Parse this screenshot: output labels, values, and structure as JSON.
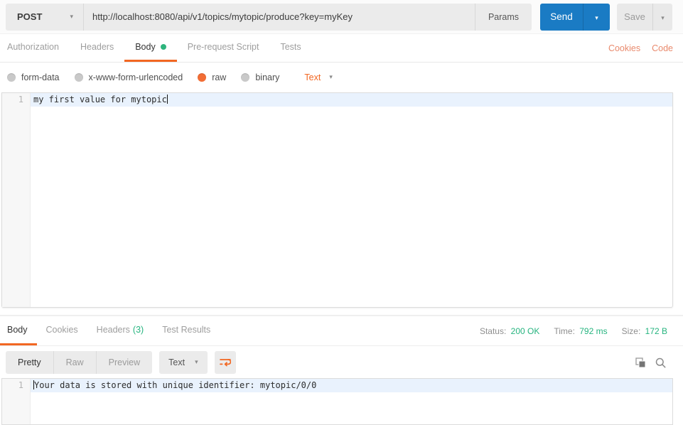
{
  "request": {
    "method": "POST",
    "url": "http://localhost:8080/api/v1/topics/mytopic/produce?key=myKey",
    "params_label": "Params",
    "send_label": "Send",
    "save_label": "Save"
  },
  "request_tabs": {
    "items": [
      "Authorization",
      "Headers",
      "Body",
      "Pre-request Script",
      "Tests"
    ],
    "active": "Body",
    "cookies_link": "Cookies",
    "code_link": "Code"
  },
  "body_type": {
    "options": [
      "form-data",
      "x-www-form-urlencoded",
      "raw",
      "binary"
    ],
    "selected": "raw",
    "format_selected": "Text"
  },
  "request_editor": {
    "line_number": "1",
    "line_content": "my first value for mytopic"
  },
  "response": {
    "tabs": [
      "Body",
      "Cookies",
      "Headers",
      "Test Results"
    ],
    "headers_count": "(3)",
    "active_tab": "Body",
    "status_label": "Status:",
    "status_value": "200 OK",
    "time_label": "Time:",
    "time_value": "792 ms",
    "size_label": "Size:",
    "size_value": "172 B",
    "view_modes": [
      "Pretty",
      "Raw",
      "Preview"
    ],
    "active_mode": "Pretty",
    "format_selected": "Text",
    "editor": {
      "line_number": "1",
      "line_content": "Your data is stored with unique identifier: mytopic/0/0"
    }
  },
  "icons": {
    "method_dropdown": "chevron-down-icon",
    "send_options": "chevron-down-icon",
    "save_options": "chevron-down-icon",
    "body_active_indicator": "green-dot-icon",
    "wrap": "wrap-text-icon",
    "copy": "copy-icon",
    "search": "search-icon"
  },
  "colors": {
    "accent_orange": "#f26722",
    "link_orange": "#e98a6d",
    "send_blue": "#1a7bc4",
    "status_green": "#26b47f",
    "active_line_highlight": "#e9f2fd"
  }
}
